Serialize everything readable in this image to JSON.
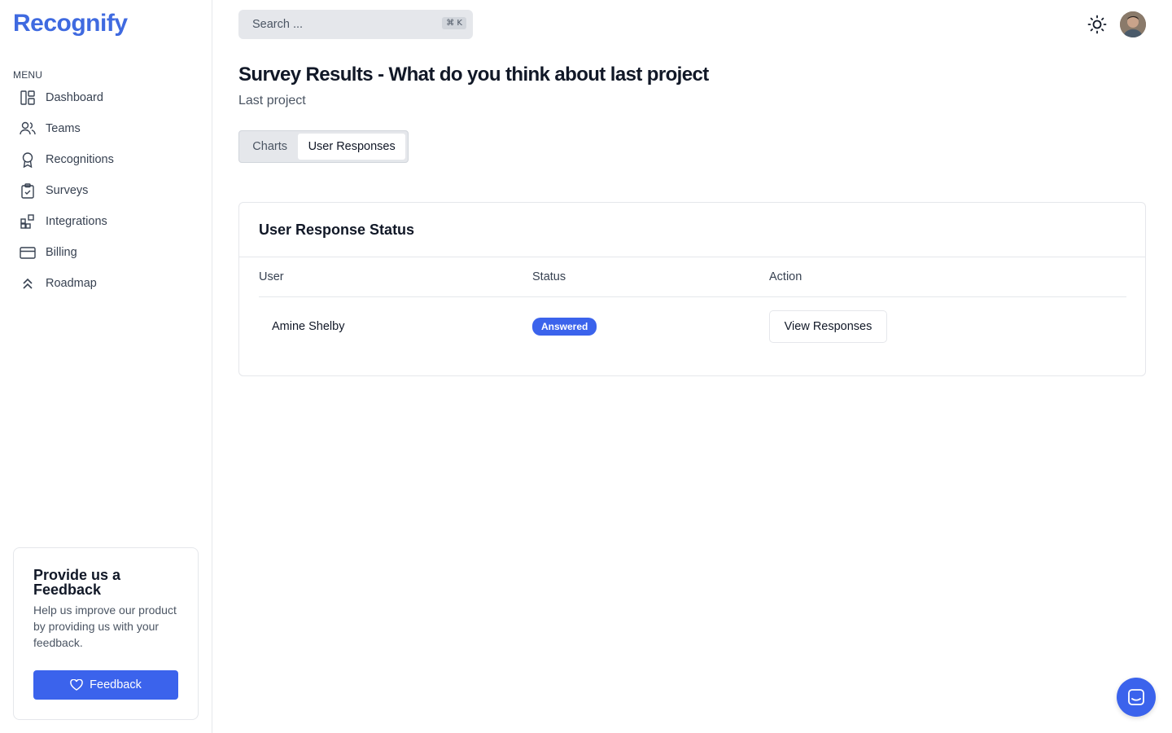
{
  "app": {
    "logo_text": "Recognify",
    "brand_color": "#3f6ae0"
  },
  "sidebar": {
    "menu_label": "MENU",
    "items": [
      {
        "label": "Dashboard",
        "icon": "dashboard-icon"
      },
      {
        "label": "Teams",
        "icon": "users-icon"
      },
      {
        "label": "Recognitions",
        "icon": "award-icon"
      },
      {
        "label": "Surveys",
        "icon": "clipboard-check-icon"
      },
      {
        "label": "Integrations",
        "icon": "integrations-icon"
      },
      {
        "label": "Billing",
        "icon": "credit-card-icon"
      },
      {
        "label": "Roadmap",
        "icon": "chevrons-up-icon"
      }
    ],
    "feedback": {
      "title": "Provide us a Feedback",
      "text": "Help us improve our product by providing us with your feedback.",
      "button_label": "Feedback"
    }
  },
  "header": {
    "search_placeholder": "Search ...",
    "search_shortcut": "⌘ K"
  },
  "main": {
    "title": "Survey Results - What do you think about last project",
    "subtitle": "Last project",
    "tabs": [
      {
        "label": "Charts",
        "active": false
      },
      {
        "label": "User Responses",
        "active": true
      }
    ],
    "card": {
      "title": "User Response Status",
      "columns": [
        "User",
        "Status",
        "Action"
      ],
      "rows": [
        {
          "user": "Amine Shelby",
          "status": "Answered",
          "action": "View Responses"
        }
      ]
    }
  },
  "colors": {
    "primary": "#3b63ec",
    "badge": "#3b63ec"
  }
}
